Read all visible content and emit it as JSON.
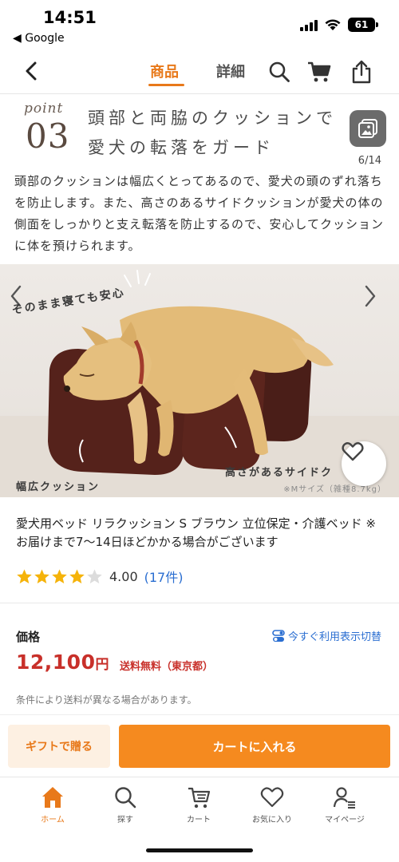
{
  "status_bar": {
    "time": "14:51",
    "back_app": "◀ Google",
    "battery": "61"
  },
  "nav": {
    "tabs": [
      {
        "label": "商品",
        "active": true
      },
      {
        "label": "詳細",
        "active": false
      }
    ],
    "icons": [
      "back-icon",
      "search-icon",
      "cart-icon",
      "share-icon"
    ],
    "accent_color": "#e8791a"
  },
  "banner": {
    "point_word": "point",
    "point_number": "03",
    "title_line1": "頭部と両脇のクッションで",
    "title_line2": "愛犬の転落をガード",
    "description": "頭部のクッションは幅広くとってあるので、愛犬の頭のずれ落ちを防止します。また、高さのあるサイドクッションが愛犬の体の側面をしっかりと支え転落を防止するので、安心してクッションに体を預けられます。",
    "image_counter": "6/14"
  },
  "photo": {
    "caption_top": "そのまま寝ても安心",
    "caption_left": "幅広クッション",
    "caption_right": "高さがあるサイドク",
    "note": "※Mサイズ（雑種8.7kg）"
  },
  "product": {
    "title": "愛犬用ベッド リラクッション S ブラウン 立位保定・介護ベッド ※お届けまで7〜14日ほどかかる場合がございます",
    "rating_value": "4.00",
    "rating_stars": 4,
    "rating_max": 5,
    "review_count": "(17件)"
  },
  "price": {
    "label": "価格",
    "switch_label": "今すぐ利用表示切替",
    "amount": "12,100",
    "unit": "円",
    "shipping": "送料無料（東京都）",
    "note": "条件により送料が異なる場合があります。",
    "color": "#c8302a"
  },
  "actions": {
    "gift_label": "ギフトで贈る",
    "cart_label": "カートに入れる"
  },
  "tab_bar": {
    "items": [
      {
        "label": "ホーム",
        "icon": "home-icon",
        "active": true
      },
      {
        "label": "探す",
        "icon": "search-icon",
        "active": false
      },
      {
        "label": "カート",
        "icon": "cart-icon",
        "active": false
      },
      {
        "label": "お気に入り",
        "icon": "heart-icon",
        "active": false
      },
      {
        "label": "マイページ",
        "icon": "user-icon",
        "active": false
      }
    ]
  }
}
